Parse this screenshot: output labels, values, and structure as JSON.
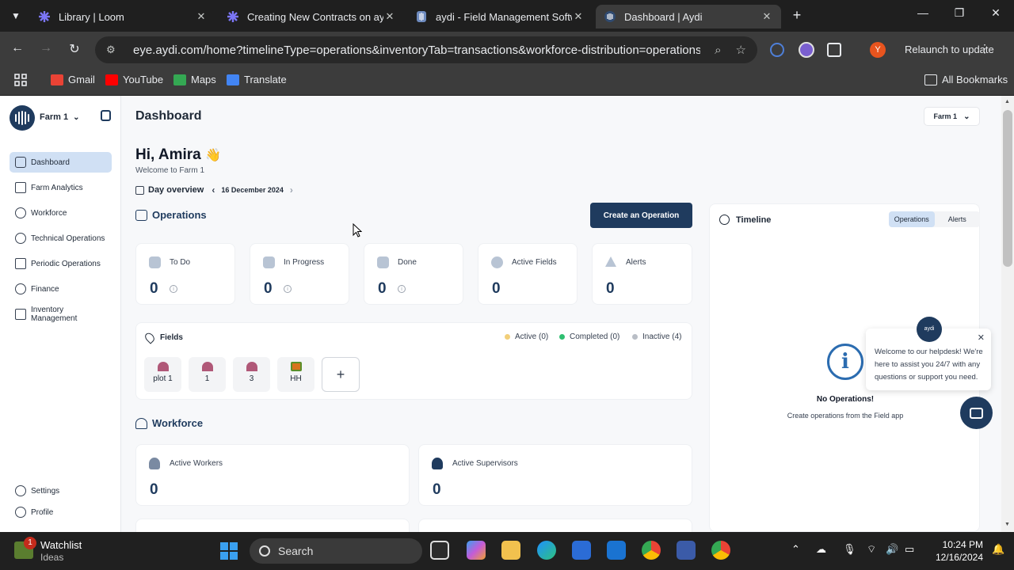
{
  "browser": {
    "tabs": [
      {
        "title": "Library | Loom",
        "favicon_color": "#625df5"
      },
      {
        "title": "Creating New Contracts on aydi",
        "favicon_color": "#625df5"
      },
      {
        "title": "aydi - Field Management Softw",
        "favicon_color": "#4a6fa5"
      },
      {
        "title": "Dashboard | Aydi",
        "favicon_color": "#4a6fa5"
      }
    ],
    "new_tab": "+",
    "url": "eye.aydi.com/home?timelineType=operations&inventoryTab=transactions&workforce-distribution=operations&res...",
    "profile_initial": "Y",
    "relaunch_label": "Relaunch to update",
    "bookmarks": [
      {
        "label": "Gmail",
        "color": "#ea4335"
      },
      {
        "label": "YouTube",
        "color": "#ff0000"
      },
      {
        "label": "Maps",
        "color": "#34a853"
      },
      {
        "label": "Translate",
        "color": "#4285f4"
      }
    ],
    "all_bookmarks": "All Bookmarks"
  },
  "sidebar": {
    "farm_label": "Farm 1",
    "items": [
      {
        "label": "Dashboard",
        "active": true
      },
      {
        "label": "Farm Analytics"
      },
      {
        "label": "Workforce"
      },
      {
        "label": "Technical Operations"
      },
      {
        "label": "Periodic Operations"
      },
      {
        "label": "Finance"
      },
      {
        "label": "Inventory Management"
      }
    ],
    "bottom_items": [
      {
        "label": "Settings"
      },
      {
        "label": "Profile"
      }
    ]
  },
  "header": {
    "title": "Dashboard",
    "farm_selector": "Farm 1"
  },
  "greeting": {
    "title": "Hi, Amira",
    "emoji": "👋",
    "subtitle": "Welcome to Farm 1"
  },
  "day_overview": {
    "label": "Day overview",
    "date": "16 December 2024"
  },
  "operations": {
    "title": "Operations",
    "create_label": "Create an Operation",
    "stats": [
      {
        "label": "To Do",
        "value": "0",
        "info": true
      },
      {
        "label": "In Progress",
        "value": "0",
        "info": true
      },
      {
        "label": "Done",
        "value": "0",
        "info": true
      },
      {
        "label": "Active Fields",
        "value": "0"
      },
      {
        "label": "Alerts",
        "value": "0"
      }
    ]
  },
  "fields": {
    "title": "Fields",
    "legend": [
      {
        "label": "Active (0)",
        "color": "#f2cf7a"
      },
      {
        "label": "Completed (0)",
        "color": "#2fbf71"
      },
      {
        "label": "Inactive (4)",
        "color": "#b9bec6"
      }
    ],
    "items": [
      {
        "label": "plot 1",
        "icon_color": "#b05878"
      },
      {
        "label": "1",
        "icon_color": "#b05878"
      },
      {
        "label": "3",
        "icon_color": "#b05878"
      },
      {
        "label": "HH",
        "icon_color": "#d8731e"
      }
    ],
    "add": "+"
  },
  "workforce": {
    "title": "Workforce",
    "cards": [
      {
        "label": "Active Workers",
        "value": "0"
      },
      {
        "label": "Active Supervisors",
        "value": "0"
      }
    ]
  },
  "timeline": {
    "title": "Timeline",
    "tabs": [
      {
        "label": "Operations",
        "active": true
      },
      {
        "label": "Alerts"
      }
    ],
    "empty_title": "No Operations!",
    "empty_subtitle": "Create operations from the Field app"
  },
  "helpdesk": {
    "badge": "aydi",
    "message": "Welcome to our helpdesk! We're here to assist you 24/7 with any questions or support you need."
  },
  "taskbar": {
    "widget_title": "Watchlist",
    "widget_subtitle": "Ideas",
    "widget_badge": "1",
    "search_placeholder": "Search",
    "time": "10:24 PM",
    "date": "12/16/2024"
  }
}
